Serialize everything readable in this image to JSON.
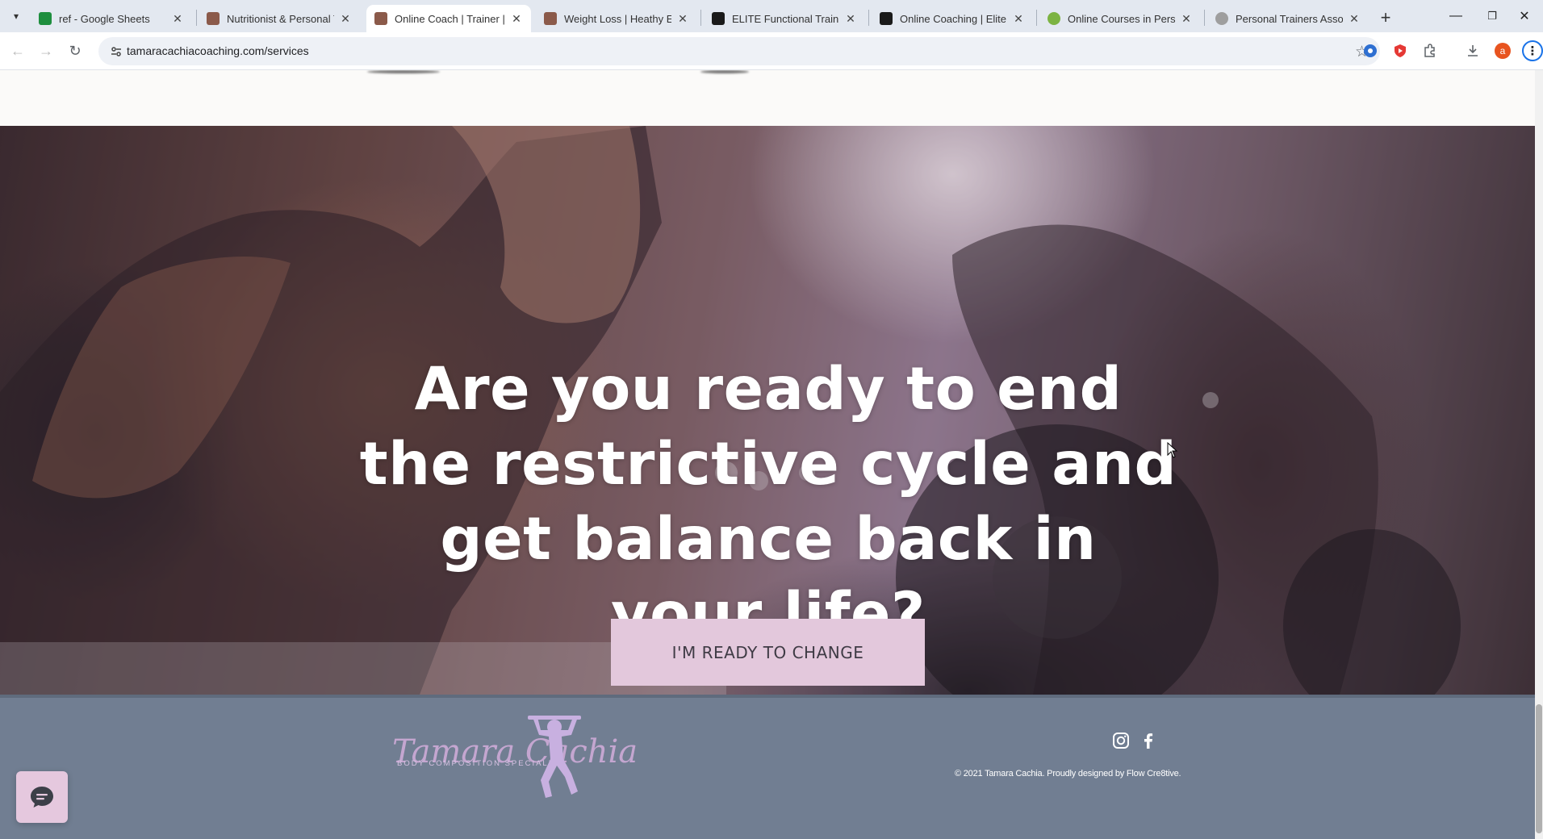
{
  "browser": {
    "tabs": [
      {
        "title": "ref - Google Sheets",
        "favicon_color": "#1e8e3e",
        "active": false
      },
      {
        "title": "Nutritionist & Personal Tr",
        "favicon_color": "#8b5a4a",
        "active": false
      },
      {
        "title": "Online Coach | Trainer | N",
        "favicon_color": "#8b5a4a",
        "active": true
      },
      {
        "title": "Weight Loss | Heathy Eati",
        "favicon_color": "#8b5a4a",
        "active": false
      },
      {
        "title": "ELITE Functional Training",
        "favicon_color": "#1a1a1a",
        "active": false
      },
      {
        "title": "Online Coaching | Elite Fu",
        "favicon_color": "#1a1a1a",
        "active": false
      },
      {
        "title": "Online Courses in Persona",
        "favicon_color": "#7cb342",
        "active": false
      },
      {
        "title": "Personal Trainers Associat",
        "favicon_color": "#9e9e9e",
        "active": false
      }
    ],
    "url": "tamaracachiacoaching.com/services",
    "profile_initial": "a"
  },
  "hero": {
    "headline": "Are you ready to end the restrictive cycle and get balance back in your life?",
    "cta_label": "I'M READY TO CHANGE"
  },
  "footer": {
    "logo_script": "Tamara Cachia",
    "logo_subtitle": "BODY COMPOSITION SPECIALIST",
    "copyright": "© 2021 Tamara Cachia.  Proudly designed by Flow Cre8tive.",
    "social": [
      "instagram-icon",
      "facebook-icon"
    ]
  },
  "colors": {
    "cta_bg": "#e3c8dc",
    "footer_bg": "#717e92",
    "chat_bg": "#e5c8de"
  }
}
